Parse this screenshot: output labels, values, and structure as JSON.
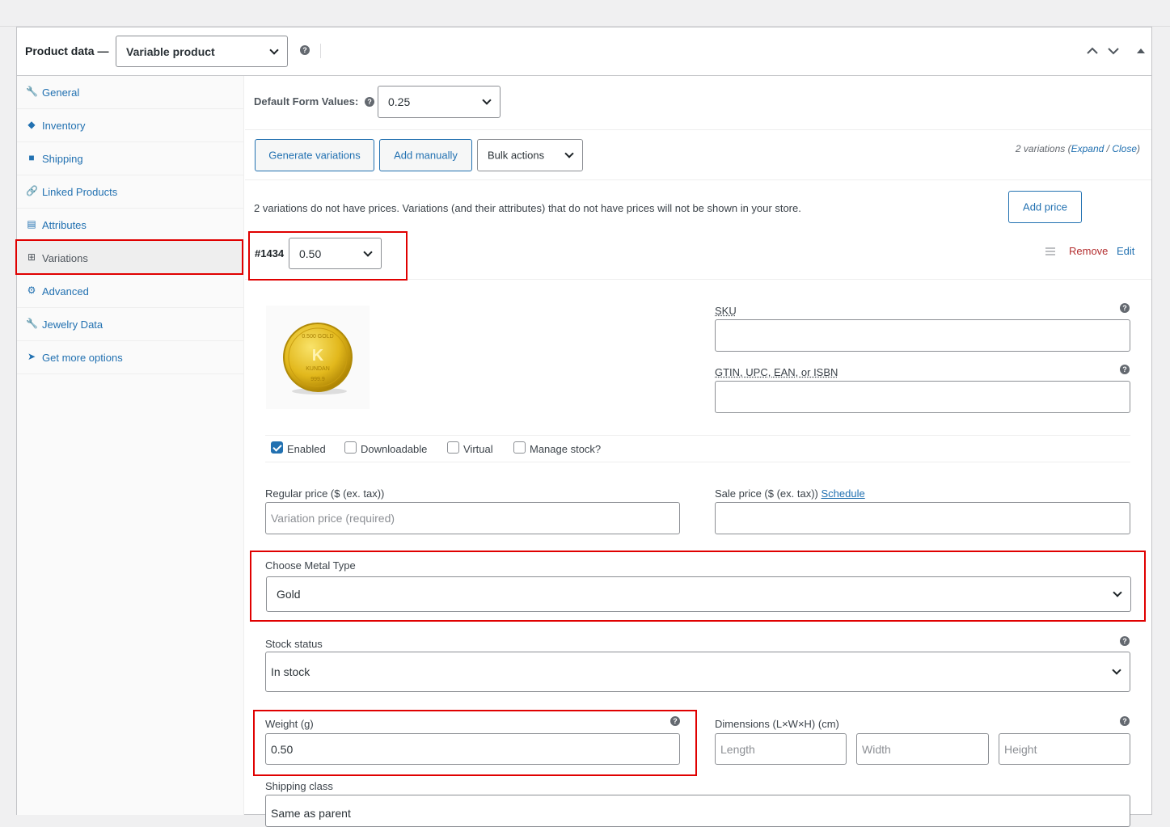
{
  "header": {
    "title": "Product data —",
    "product_type": "Variable product"
  },
  "sidebar": {
    "items": [
      {
        "label": "General",
        "icon": "wrench-icon"
      },
      {
        "label": "Inventory",
        "icon": "tag-icon"
      },
      {
        "label": "Shipping",
        "icon": "truck-icon"
      },
      {
        "label": "Linked Products",
        "icon": "link-icon"
      },
      {
        "label": "Attributes",
        "icon": "list-icon"
      },
      {
        "label": "Variations",
        "icon": "grid-icon"
      },
      {
        "label": "Advanced",
        "icon": "gear-icon"
      },
      {
        "label": "Jewelry Data",
        "icon": "wrench-icon"
      },
      {
        "label": "Get more options",
        "icon": "plugin-icon"
      }
    ],
    "active": "Variations"
  },
  "defaults": {
    "label": "Default Form Values:",
    "value": "0.25"
  },
  "toolbar": {
    "generate": "Generate variations",
    "add_manually": "Add manually",
    "bulk_actions": "Bulk actions",
    "count_text": "2 variations (",
    "expand": "Expand",
    "sep": " / ",
    "close": "Close",
    "count_end": ")"
  },
  "notice": {
    "text": "2 variations do not have prices. Variations (and their attributes) that do not have prices will not be shown in your store.",
    "add_price": "Add price"
  },
  "variation": {
    "id": "#1434",
    "value": "0.50",
    "remove": "Remove",
    "edit": "Edit",
    "image_text_top": "0.500 GOLD",
    "image_letter": "K",
    "image_text_mid": "KUNDAN",
    "image_text_bot": "999.9",
    "sku_label": "SKU",
    "gtin_label": "GTIN, UPC, EAN, or ISBN",
    "enabled": "Enabled",
    "downloadable": "Downloadable",
    "virtual": "Virtual",
    "manage_stock": "Manage stock?",
    "regular_price_label": "Regular price ($ (ex. tax))",
    "regular_price_placeholder": "Variation price (required)",
    "sale_price_label": "Sale price ($ (ex. tax))",
    "schedule": "Schedule",
    "metal_label": "Choose Metal Type",
    "metal_value": "Gold",
    "stock_label": "Stock status",
    "stock_value": "In stock",
    "weight_label": "Weight (g)",
    "weight_value": "0.50",
    "dimensions_label": "Dimensions (L×W×H) (cm)",
    "length_placeholder": "Length",
    "width_placeholder": "Width",
    "height_placeholder": "Height",
    "shipping_label": "Shipping class",
    "shipping_value": "Same as parent"
  },
  "colors": {
    "accent": "#2271b1",
    "danger": "#b32d2e",
    "highlight": "#e00000"
  }
}
